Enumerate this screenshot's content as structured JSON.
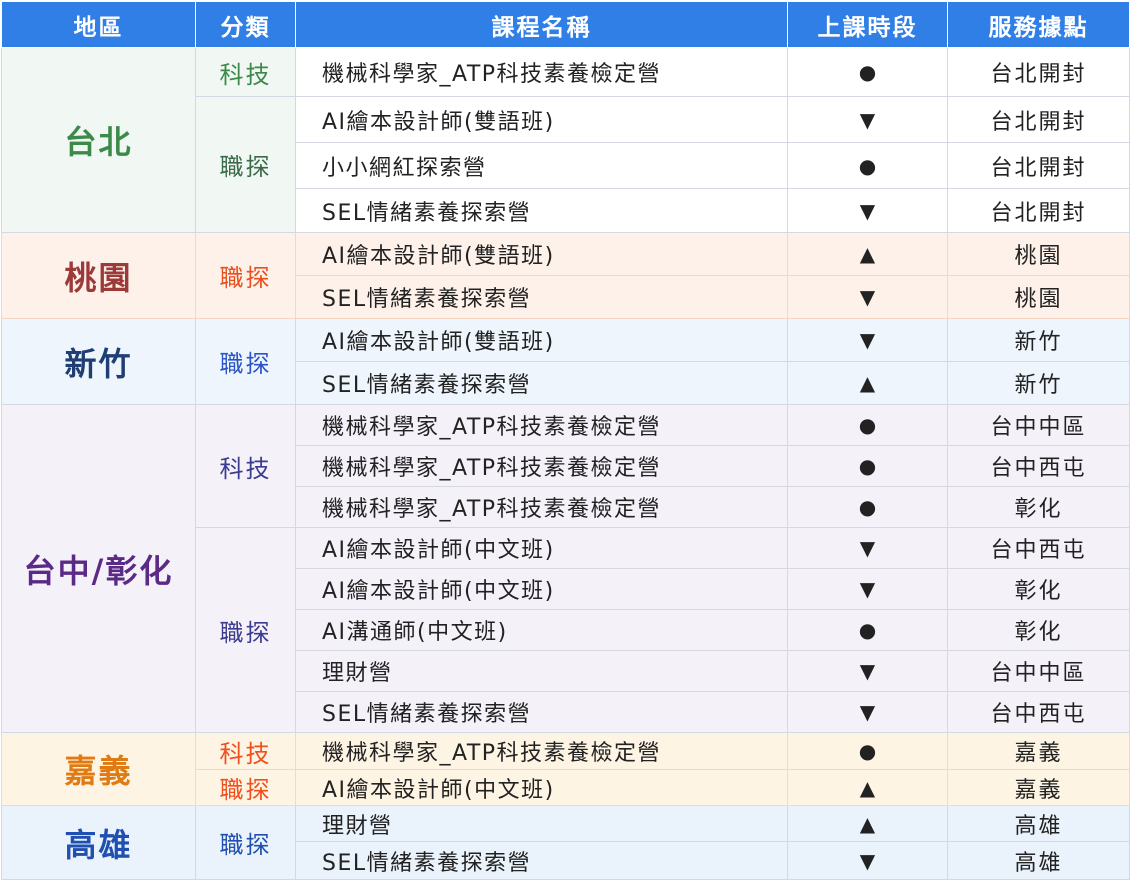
{
  "headers": [
    "地區",
    "分類",
    "課程名稱",
    "上課時段",
    "服務據點"
  ],
  "colors": {
    "header_bg": "#2f7fe6",
    "taipei": "#3b8a4a",
    "taoyuan": "#9c3a3a",
    "taoyuan_cat": "#e8501e",
    "hsinchu": "#1f3f74",
    "hsinchu_cat": "#2a55c8",
    "taichung": "#5b2a86",
    "taichung_cat": "#3b3b8f",
    "chiayi": "#e07a12",
    "chiayi_cat": "#f0501e",
    "kaohsiung": "#1f4fb0",
    "kaohsiung_cat": "#1f4fb0"
  },
  "regions": {
    "taipei": "台北",
    "taoyuan": "桃園",
    "hsinchu": "新竹",
    "taichung": "台中/彰化",
    "chiayi": "嘉義",
    "kaohsiung": "高雄"
  },
  "categories": {
    "taipei_tech": "科技",
    "taipei_explore": "職探",
    "taoyuan_explore": "職探",
    "hsinchu_explore": "職探",
    "taichung_tech": "科技",
    "taichung_explore": "職探",
    "chiayi_tech": "科技",
    "chiayi_explore": "職探",
    "kaohsiung_explore": "職探"
  },
  "rows": [
    {
      "course": "機械科學家_ATP科技素養檢定營",
      "time": "●",
      "location": "台北開封"
    },
    {
      "course": "AI繪本設計師(雙語班)",
      "time": "▼",
      "location": "台北開封"
    },
    {
      "course": "小小網紅探索營",
      "time": "●",
      "location": "台北開封"
    },
    {
      "course": "SEL情緒素養探索營",
      "time": "▼",
      "location": "台北開封"
    },
    {
      "course": "AI繪本設計師(雙語班)",
      "time": "▲",
      "location": "桃園"
    },
    {
      "course": "SEL情緒素養探索營",
      "time": "▼",
      "location": "桃園"
    },
    {
      "course": "AI繪本設計師(雙語班)",
      "time": "▼",
      "location": "新竹"
    },
    {
      "course": "SEL情緒素養探索營",
      "time": "▲",
      "location": "新竹"
    },
    {
      "course": "機械科學家_ATP科技素養檢定營",
      "time": "●",
      "location": "台中中區"
    },
    {
      "course": "機械科學家_ATP科技素養檢定營",
      "time": "●",
      "location": "台中西屯"
    },
    {
      "course": "機械科學家_ATP科技素養檢定營",
      "time": "●",
      "location": "彰化"
    },
    {
      "course": "AI繪本設計師(中文班)",
      "time": "▼",
      "location": "台中西屯"
    },
    {
      "course": "AI繪本設計師(中文班)",
      "time": "▼",
      "location": "彰化"
    },
    {
      "course": "AI溝通師(中文班)",
      "time": "●",
      "location": "彰化"
    },
    {
      "course": "理財營",
      "time": "▼",
      "location": "台中中區"
    },
    {
      "course": "SEL情緒素養探索營",
      "time": "▼",
      "location": "台中西屯"
    },
    {
      "course": "機械科學家_ATP科技素養檢定營",
      "time": "●",
      "location": "嘉義"
    },
    {
      "course": "AI繪本設計師(中文班)",
      "time": "▲",
      "location": "嘉義"
    },
    {
      "course": "理財營",
      "time": "▲",
      "location": "高雄"
    },
    {
      "course": "SEL情緒素養探索營",
      "time": "▼",
      "location": "高雄"
    }
  ]
}
